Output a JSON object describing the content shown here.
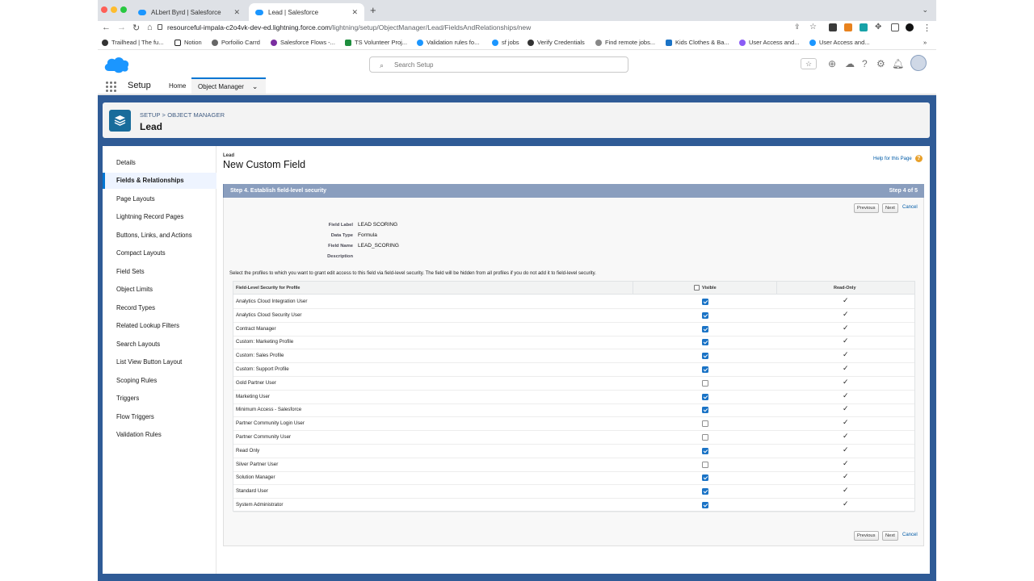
{
  "browser": {
    "tabs": [
      {
        "label": "ALbert Byrd | Salesforce",
        "active": false
      },
      {
        "label": "Lead | Salesforce",
        "active": true
      }
    ],
    "url_host": "resourceful-impala-c2o4vk-dev-ed.lightning.force.com",
    "url_path": "/lightning/setup/ObjectManager/Lead/FieldsAndRelationships/new",
    "bookmarks": [
      "Trailhead | The fu...",
      "Notion",
      "Porfoilio Carrd",
      "Salesforce Flows -...",
      "TS Volunteer Proj...",
      "Validation rules fo...",
      "sf jobs",
      "Verify Credentials",
      "Find remote jobs...",
      "Kids Clothes & Ba...",
      "User Access and...",
      "User Access and..."
    ],
    "bookmarks_more": "»"
  },
  "header": {
    "search_placeholder": "Search Setup"
  },
  "context": {
    "app_title": "Setup",
    "tabs": [
      "Home",
      "Object Manager"
    ],
    "dropdown_glyph": "⌄"
  },
  "object": {
    "breadcrumb_setup": "SETUP",
    "breadcrumb_sep": " > ",
    "breadcrumb_om": "OBJECT MANAGER",
    "title": "Lead"
  },
  "sidebar": {
    "items": [
      "Details",
      "Fields & Relationships",
      "Page Layouts",
      "Lightning Record Pages",
      "Buttons, Links, and Actions",
      "Compact Layouts",
      "Field Sets",
      "Object Limits",
      "Record Types",
      "Related Lookup Filters",
      "Search Layouts",
      "List View Button Layout",
      "Scoping Rules",
      "Triggers",
      "Flow Triggers",
      "Validation Rules"
    ],
    "active_index": 1
  },
  "page": {
    "object_label": "Lead",
    "title": "New Custom Field",
    "help_link": "Help for this Page",
    "help_glyph": "?",
    "step_title": "Step 4. Establish field-level security",
    "step_count": "Step 4 of 5",
    "buttons": {
      "previous": "Previous",
      "next": "Next",
      "cancel": "Cancel"
    },
    "fields": [
      {
        "label": "Field Label",
        "value": "LEAD SCORING"
      },
      {
        "label": "Data Type",
        "value": "Formula"
      },
      {
        "label": "Field Name",
        "value": "LEAD_SCORING"
      },
      {
        "label": "Description",
        "value": ""
      }
    ],
    "instructions": "Select the profiles to which you want to grant edit access to this field via field-level security. The field will be hidden from all profiles if you do not add it to field-level security."
  },
  "table": {
    "col_profile": "Field-Level Security for Profile",
    "col_visible": "Visible",
    "col_readonly": "Read-Only",
    "tick_glyph": "✓",
    "rows": [
      {
        "name": "Analytics Cloud Integration User",
        "visible": true,
        "readonly": true
      },
      {
        "name": "Analytics Cloud Security User",
        "visible": true,
        "readonly": true
      },
      {
        "name": "Contract Manager",
        "visible": true,
        "readonly": true
      },
      {
        "name": "Custom: Marketing Profile",
        "visible": true,
        "readonly": true
      },
      {
        "name": "Custom: Sales Profile",
        "visible": true,
        "readonly": true
      },
      {
        "name": "Custom: Support Profile",
        "visible": true,
        "readonly": true
      },
      {
        "name": "Gold Partner User",
        "visible": false,
        "readonly": true
      },
      {
        "name": "Marketing User",
        "visible": true,
        "readonly": true
      },
      {
        "name": "Minimum Access - Salesforce",
        "visible": true,
        "readonly": true
      },
      {
        "name": "Partner Community Login User",
        "visible": false,
        "readonly": true
      },
      {
        "name": "Partner Community User",
        "visible": false,
        "readonly": true
      },
      {
        "name": "Read Only",
        "visible": true,
        "readonly": true
      },
      {
        "name": "Silver Partner User",
        "visible": false,
        "readonly": true
      },
      {
        "name": "Solution Manager",
        "visible": true,
        "readonly": true
      },
      {
        "name": "Standard User",
        "visible": true,
        "readonly": true
      },
      {
        "name": "System Administrator",
        "visible": true,
        "readonly": true
      }
    ]
  },
  "colors": {
    "salesforce_blue": "#1b96ff",
    "page_bg": "#2f5b96",
    "step_bar": "#8a9ebe",
    "checkbox_checked": "#1a73c6",
    "link": "#015ba7"
  }
}
